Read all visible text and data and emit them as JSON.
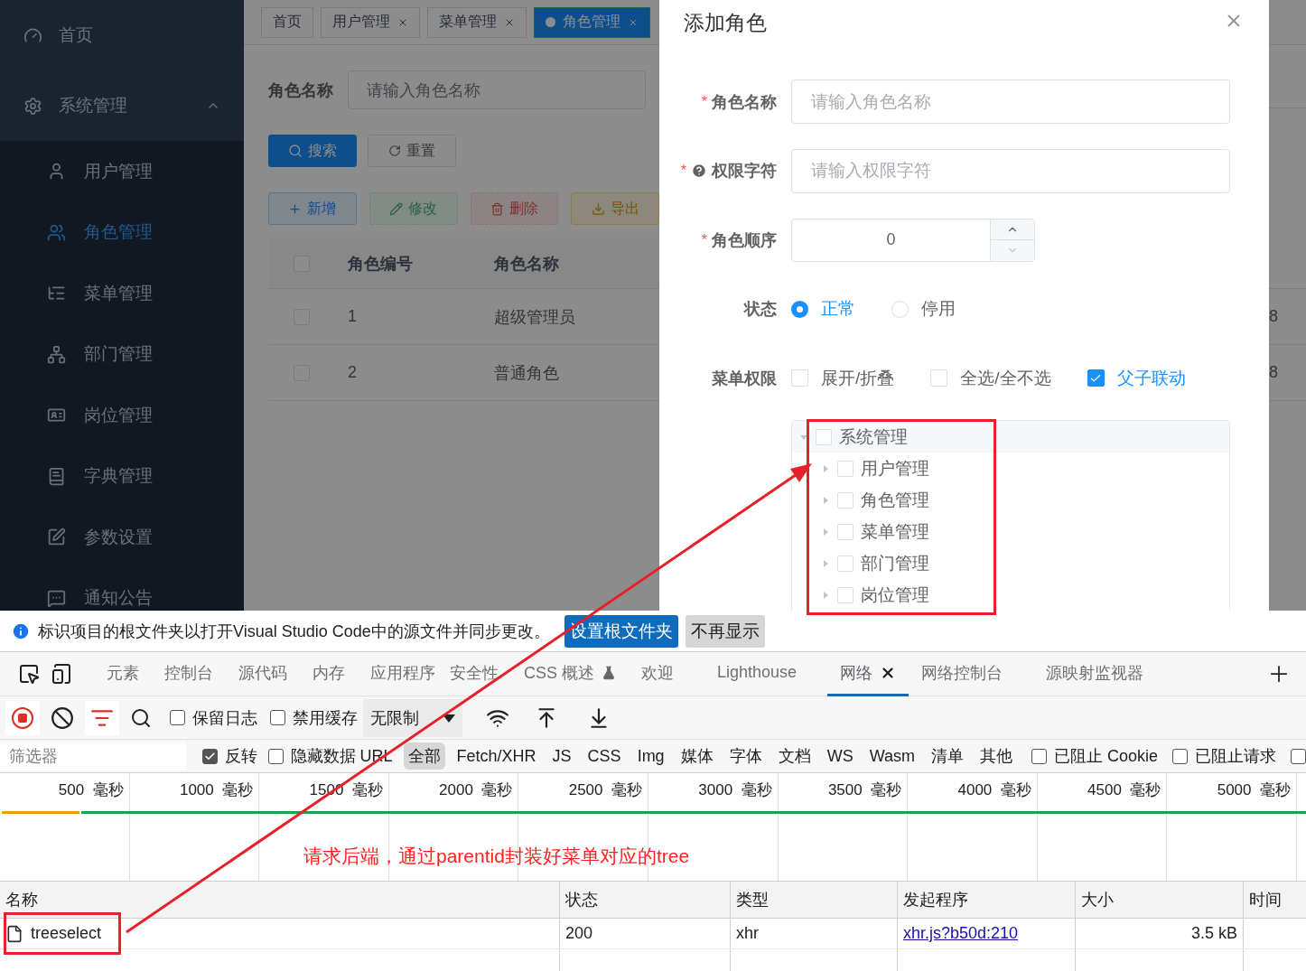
{
  "sidebar": {
    "items": [
      {
        "label": "首页",
        "selected": false
      },
      {
        "label": "系统管理",
        "selected": false,
        "expanded": true,
        "children": [
          {
            "label": "用户管理",
            "selected": false
          },
          {
            "label": "角色管理",
            "selected": true
          },
          {
            "label": "菜单管理",
            "selected": false
          },
          {
            "label": "部门管理",
            "selected": false
          },
          {
            "label": "岗位管理",
            "selected": false
          },
          {
            "label": "字典管理",
            "selected": false
          },
          {
            "label": "参数设置",
            "selected": false
          },
          {
            "label": "通知公告",
            "selected": false
          }
        ]
      }
    ]
  },
  "tags_view": [
    {
      "label": "首页",
      "closable": false,
      "selected": false
    },
    {
      "label": "用户管理",
      "closable": true,
      "selected": false
    },
    {
      "label": "菜单管理",
      "closable": true,
      "selected": false
    },
    {
      "label": "角色管理",
      "closable": true,
      "selected": true
    }
  ],
  "search_form": {
    "label": "角色名称",
    "placeholder": "请输入角色名称"
  },
  "search_buttons": [
    {
      "label": "搜索",
      "kind": "primary"
    },
    {
      "label": "重置",
      "kind": "default"
    }
  ],
  "toolbar_buttons": [
    {
      "label": "新增",
      "kind": "primary",
      "disabled": false
    },
    {
      "label": "修改",
      "kind": "success",
      "disabled": true
    },
    {
      "label": "删除",
      "kind": "danger",
      "disabled": true
    },
    {
      "label": "导出",
      "kind": "warning",
      "disabled": false
    }
  ],
  "table": {
    "header_checked": false,
    "columns": [
      "角色编号",
      "角色名称"
    ],
    "rows": [
      {
        "checked": false,
        "cells": [
          "1",
          "超级管理员",
          "8"
        ]
      },
      {
        "checked": false,
        "cells": [
          "2",
          "普通角色",
          "8"
        ]
      }
    ]
  },
  "dialog": {
    "title": "添加角色",
    "fields": [
      {
        "kind": "text",
        "label": "角色名称",
        "required_mark": "*",
        "placeholder": "请输入角色名称"
      },
      {
        "kind": "text",
        "label": "权限字符",
        "required_mark": "*",
        "help": true,
        "placeholder": "请输入权限字符"
      },
      {
        "kind": "number",
        "label": "角色顺序",
        "required_mark": "*",
        "value": "0"
      },
      {
        "kind": "radio",
        "label": "状态",
        "options": [
          {
            "label": "正常",
            "selected": true
          },
          {
            "label": "停用",
            "selected": false
          }
        ]
      },
      {
        "kind": "tree",
        "label": "菜单权限",
        "options": [
          {
            "label": "展开/折叠",
            "checked": false
          },
          {
            "label": "全选/全不选",
            "checked": false
          },
          {
            "label": "父子联动",
            "checked": true
          }
        ],
        "tree": [
          {
            "label": "系统管理",
            "checked": false,
            "expanded": true,
            "children": [
              {
                "label": "用户管理",
                "checked": false,
                "expanded": false
              },
              {
                "label": "角色管理",
                "checked": false,
                "expanded": false
              },
              {
                "label": "菜单管理",
                "checked": false,
                "expanded": false
              },
              {
                "label": "部门管理",
                "checked": false,
                "expanded": false
              },
              {
                "label": "岗位管理",
                "checked": false,
                "expanded": false
              }
            ]
          }
        ]
      }
    ]
  },
  "notice": {
    "text": "标识项目的根文件夹以打开Visual Studio Code中的源文件并同步更改。",
    "buttons": [
      {
        "label": "设置根文件夹",
        "kind": "primary"
      },
      {
        "label": "不再显示",
        "kind": "secondary"
      }
    ]
  },
  "devtools_tabs": [
    {
      "label": "元素",
      "selected": false,
      "experimental": false,
      "closable": false
    },
    {
      "label": "控制台",
      "selected": false,
      "experimental": false,
      "closable": false
    },
    {
      "label": "源代码",
      "selected": false,
      "experimental": false,
      "closable": false
    },
    {
      "label": "内存",
      "selected": false,
      "experimental": false,
      "closable": false
    },
    {
      "label": "应用程序",
      "selected": false,
      "experimental": false,
      "closable": false
    },
    {
      "label": "安全性",
      "selected": false,
      "experimental": false,
      "closable": false
    },
    {
      "label": "CSS 概述",
      "selected": false,
      "experimental": true,
      "closable": false
    },
    {
      "label": "欢迎",
      "selected": false,
      "experimental": false,
      "closable": false
    },
    {
      "label": "Lighthouse",
      "selected": false,
      "experimental": false,
      "closable": false
    },
    {
      "label": "网络",
      "selected": true,
      "experimental": false,
      "closable": true
    },
    {
      "label": "网络控制台",
      "selected": false,
      "experimental": false,
      "closable": false
    },
    {
      "label": "源映射监视器",
      "selected": false,
      "experimental": false,
      "closable": false
    }
  ],
  "network_toolbar": {
    "recording": true,
    "filter_active": true,
    "checkboxes": [
      {
        "label": "保留日志",
        "checked": false
      },
      {
        "label": "禁用缓存",
        "checked": false
      }
    ],
    "throttling": "无限制"
  },
  "filter_bar": {
    "placeholder": "筛选器",
    "checkboxes_before": [
      {
        "label": "反转",
        "checked": true
      },
      {
        "label": "隐藏数据 URL",
        "checked": false
      }
    ],
    "types": [
      {
        "label": "全部",
        "selected": true
      },
      {
        "label": "Fetch/XHR",
        "selected": false
      },
      {
        "label": "JS",
        "selected": false
      },
      {
        "label": "CSS",
        "selected": false
      },
      {
        "label": "Img",
        "selected": false
      },
      {
        "label": "媒体",
        "selected": false
      },
      {
        "label": "字体",
        "selected": false
      },
      {
        "label": "文档",
        "selected": false
      },
      {
        "label": "WS",
        "selected": false
      },
      {
        "label": "Wasm",
        "selected": false
      },
      {
        "label": "清单",
        "selected": false
      },
      {
        "label": "其他",
        "selected": false
      }
    ],
    "checkboxes_after": [
      {
        "label": "已阻止 Cookie",
        "checked": false
      },
      {
        "label": "已阻止请求",
        "checked": false
      },
      {
        "checked": false
      }
    ]
  },
  "timeline": {
    "ticks": [
      "500  毫秒",
      "1000  毫秒",
      "1500  毫秒",
      "2000  毫秒",
      "2500  毫秒",
      "3000  毫秒",
      "3500  毫秒",
      "4000  毫秒",
      "4500  毫秒",
      "5000  毫秒"
    ]
  },
  "annotation": {
    "text": "请求后端，通过parentid封装好菜单对应的tree"
  },
  "requests_table": {
    "columns": [
      "名称",
      "状态",
      "类型",
      "发起程序",
      "大小",
      "时间"
    ],
    "rows": [
      {
        "name": "treeselect",
        "status": "200",
        "type": "xhr",
        "initiator": "xhr.js?b50d:210",
        "size": "3.5 kB"
      }
    ]
  }
}
